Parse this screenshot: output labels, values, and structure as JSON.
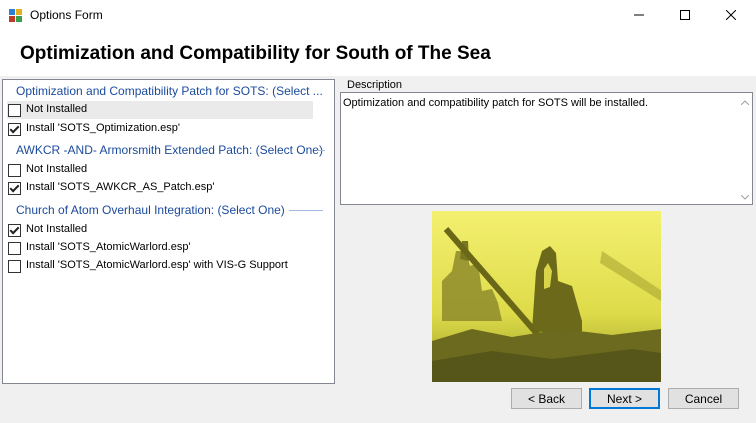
{
  "window": {
    "title": "Options Form",
    "minimize_icon": "minimize-icon",
    "maximize_icon": "maximize-icon",
    "close_icon": "close-icon"
  },
  "header": {
    "title": "Optimization and Compatibility for South of The Sea"
  },
  "groups": [
    {
      "title": "Optimization and Compatibility Patch for SOTS: (Select ...",
      "options": [
        {
          "label": "Not Installed",
          "checked": false,
          "selected": true
        },
        {
          "label": "Install 'SOTS_Optimization.esp'",
          "checked": true,
          "selected": false
        }
      ]
    },
    {
      "title": "AWKCR -AND- Armorsmith Extended Patch: (Select One)",
      "options": [
        {
          "label": "Not Installed",
          "checked": false,
          "selected": false
        },
        {
          "label": "Install 'SOTS_AWKCR_AS_Patch.esp'",
          "checked": true,
          "selected": false
        }
      ]
    },
    {
      "title": "Church of Atom Overhaul Integration: (Select One)",
      "options": [
        {
          "label": "Not Installed",
          "checked": true,
          "selected": false
        },
        {
          "label": "Install 'SOTS_AtomicWarlord.esp'",
          "checked": false,
          "selected": false
        },
        {
          "label": "Install 'SOTS_AtomicWarlord.esp' with VIS-G Support",
          "checked": false,
          "selected": false
        }
      ]
    }
  ],
  "description": {
    "label": "Description",
    "text": "Optimization and compatibility patch for SOTS will be installed."
  },
  "buttons": {
    "back": "< Back",
    "next": "Next >",
    "cancel": "Cancel"
  },
  "colors": {
    "group_title": "#1a4a9c",
    "focus_border": "#0078d7"
  }
}
